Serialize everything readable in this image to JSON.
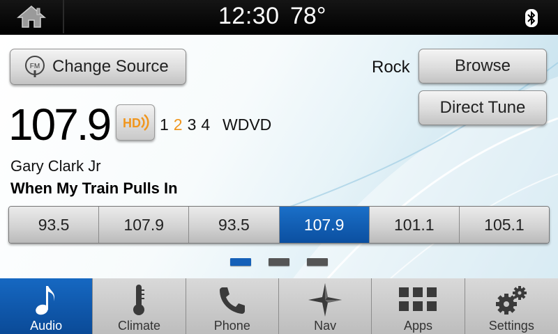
{
  "status": {
    "time": "12:30",
    "temperature": "78°",
    "home_icon": "home-icon",
    "bluetooth_icon": "bluetooth-icon"
  },
  "audio": {
    "source_button_label": "Change Source",
    "source_icon_text": "FM",
    "genre": "Rock",
    "browse_label": "Browse",
    "direct_tune_label": "Direct Tune",
    "frequency": "107.9",
    "hd_icon_text": "HD",
    "hd_channels": [
      "1",
      "2",
      "3",
      "4"
    ],
    "hd_active_channel": "2",
    "station_name": "WDVD",
    "artist": "Gary Clark Jr",
    "song": "When My Train Pulls In",
    "presets": [
      "93.5",
      "107.9",
      "93.5",
      "107.9",
      "101.1",
      "105.1"
    ],
    "selected_preset_index": 3,
    "page_count": 3,
    "current_page": 1
  },
  "nav": [
    {
      "label": "Audio",
      "icon": "music-note-icon",
      "active": true
    },
    {
      "label": "Climate",
      "icon": "thermometer-icon",
      "active": false
    },
    {
      "label": "Phone",
      "icon": "phone-icon",
      "active": false
    },
    {
      "label": "Nav",
      "icon": "compass-star-icon",
      "active": false
    },
    {
      "label": "Apps",
      "icon": "apps-grid-icon",
      "active": false
    },
    {
      "label": "Settings",
      "icon": "gears-icon",
      "active": false
    }
  ],
  "colors": {
    "accent_blue": "#0b4fa0",
    "hd_orange": "#f0961e"
  }
}
